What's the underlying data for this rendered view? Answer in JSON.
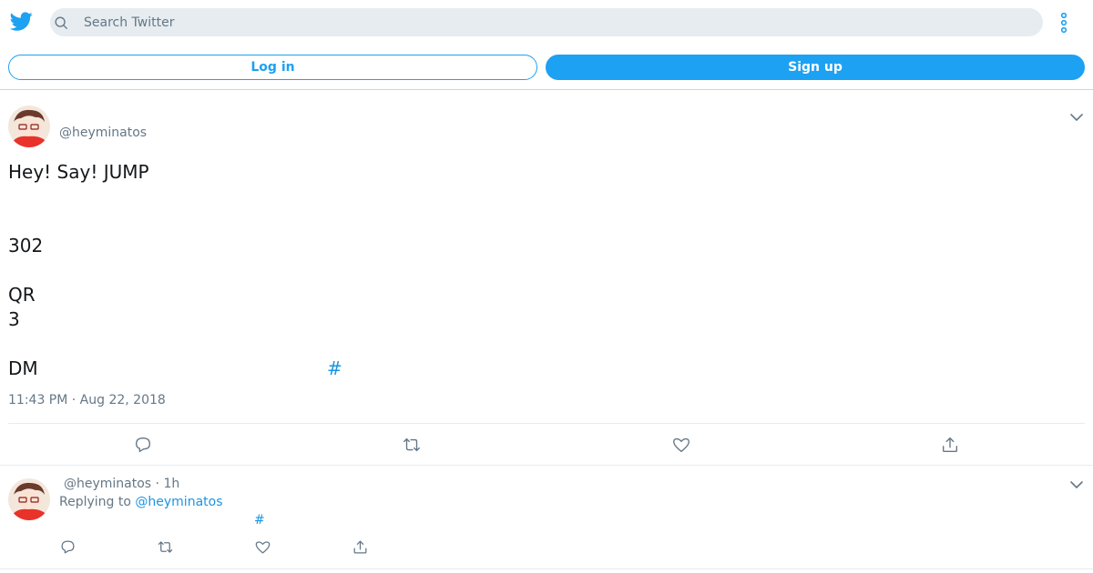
{
  "header": {
    "logo_icon": "twitter-bird-icon",
    "search": {
      "placeholder": "Search Twitter",
      "value": "",
      "icon": "search-icon"
    },
    "more_icon": "more-vertical-icon"
  },
  "auth": {
    "login_label": "Log in",
    "signup_label": "Sign up"
  },
  "tweet": {
    "handle": "@heyminatos",
    "lines": [
      "Hey! Say! JUMP",
      "302",
      "QR",
      "3",
      "DM"
    ],
    "hashtag": "#",
    "timestamp": "11:43 PM · Aug 22, 2018",
    "actions": [
      "reply-icon",
      "retweet-icon",
      "like-icon",
      "share-icon"
    ]
  },
  "reply": {
    "meta": "@heyminatos · 1h",
    "replying_prefix": "Replying to",
    "replying_handle": "@heyminatos",
    "hashtag": "#",
    "actions": [
      "reply-icon",
      "retweet-icon",
      "like-icon",
      "share-icon"
    ]
  },
  "colors": {
    "brand": "#1da1f2",
    "link": "#1b95e0",
    "muted": "#657786",
    "search_bg": "#e6ecf0",
    "text": "#14171a"
  }
}
